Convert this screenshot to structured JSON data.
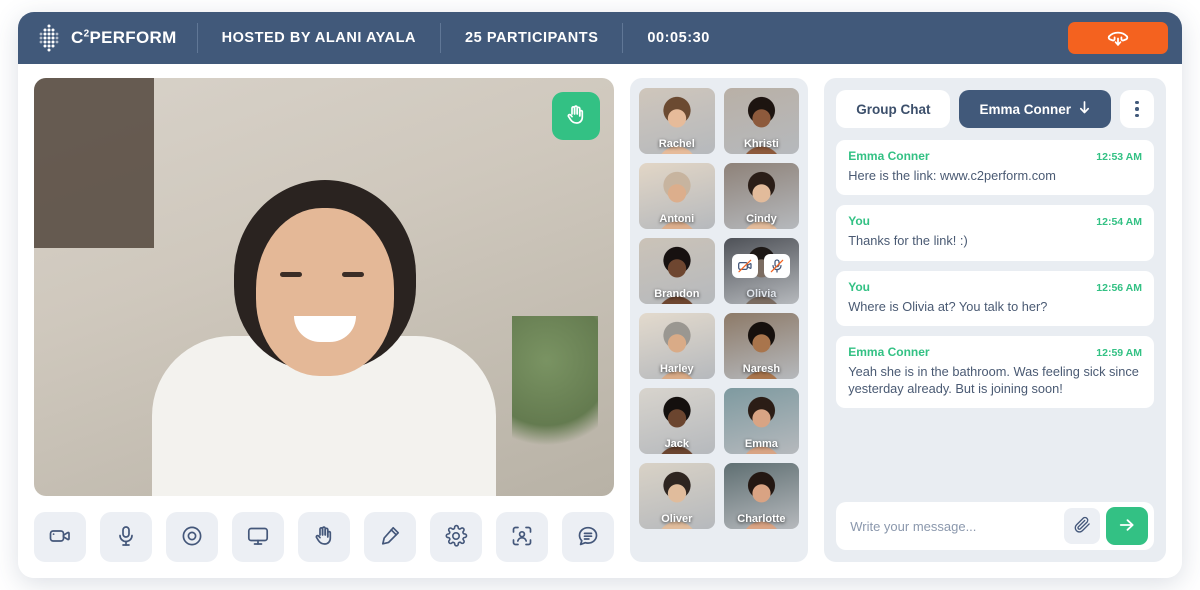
{
  "header": {
    "logo_icon": "c2perform-dot-matrix-logo",
    "logo_text": "C",
    "logo_sup": "2",
    "logo_text_rest": "PERFORM",
    "host": "HOSTED BY ALANI AYALA",
    "participants": "25 PARTICIPANTS",
    "timer": "00:05:30",
    "end_call_icon": "phone-hangup-icon"
  },
  "stage": {
    "raise_hand_icon": "raise-hand-icon",
    "controls": [
      {
        "name": "camera-toggle",
        "icon": "video-camera-icon"
      },
      {
        "name": "microphone-toggle",
        "icon": "microphone-icon"
      },
      {
        "name": "record-button",
        "icon": "record-circle-icon"
      },
      {
        "name": "share-screen-button",
        "icon": "monitor-icon"
      },
      {
        "name": "raise-hand-button",
        "icon": "raise-hand-icon"
      },
      {
        "name": "annotate-button",
        "icon": "pen-icon"
      },
      {
        "name": "settings-button",
        "icon": "gear-icon"
      },
      {
        "name": "participants-button",
        "icon": "person-frame-icon"
      },
      {
        "name": "chat-button",
        "icon": "chat-bubble-icon"
      }
    ]
  },
  "participants": [
    {
      "name": "Rachel",
      "muted": false,
      "skin": "#e6bb9a",
      "hair": "#6b4a31",
      "bg": "#cfc6bb"
    },
    {
      "name": "Khristi",
      "muted": false,
      "skin": "#8d5a3c",
      "hair": "#1d1410",
      "bg": "#b9b0a6"
    },
    {
      "name": "Antoni",
      "muted": false,
      "skin": "#dcae8c",
      "hair": "#c7b49f",
      "bg": "#e2d6c6"
    },
    {
      "name": "Cindy",
      "muted": false,
      "skin": "#e2bb9b",
      "hair": "#2a1d17",
      "bg": "#8e8279"
    },
    {
      "name": "Brandon",
      "muted": false,
      "skin": "#6e4630",
      "hair": "#171110",
      "bg": "#cbc3b8"
    },
    {
      "name": "Olivia",
      "muted": true,
      "skin": "#d7ab8b",
      "hair": "#33261f",
      "bg": "#7b8496"
    },
    {
      "name": "Harley",
      "muted": false,
      "skin": "#d9ab87",
      "hair": "#9a9791",
      "bg": "#e3dacd"
    },
    {
      "name": "Naresh",
      "muted": false,
      "skin": "#a9754c",
      "hair": "#16100d",
      "bg": "#8d7a68"
    },
    {
      "name": "Jack",
      "muted": false,
      "skin": "#6b452f",
      "hair": "#14100e",
      "bg": "#d8d4cd"
    },
    {
      "name": "Emma",
      "muted": false,
      "skin": "#d8a484",
      "hair": "#2b1d16",
      "bg": "#7e9aa0"
    },
    {
      "name": "Oliver",
      "muted": false,
      "skin": "#e0bc9c",
      "hair": "#2e2520",
      "bg": "#d9d2c6"
    },
    {
      "name": "Charlotte",
      "muted": false,
      "skin": "#d9a383",
      "hair": "#231712",
      "bg": "#5f6f72"
    }
  ],
  "muted_badges": {
    "camera_off_icon": "camera-off-icon",
    "mic_off_icon": "microphone-off-icon"
  },
  "chat": {
    "tab_group": "Group Chat",
    "tab_direct": "Emma Conner",
    "tab_direct_icon": "arrow-down-icon",
    "kebab_icon": "more-options-icon",
    "messages": [
      {
        "sender": "Emma Conner",
        "time": "12:53 AM",
        "text": "Here is the link: www.c2perform.com"
      },
      {
        "sender": "You",
        "time": "12:54 AM",
        "text": "Thanks for the link! :)"
      },
      {
        "sender": "You",
        "time": "12:56 AM",
        "text": "Where is Olivia at? You talk to her?"
      },
      {
        "sender": "Emma Conner",
        "time": "12:59 AM",
        "text": "Yeah she is in the bathroom. Was feeling sick since yesterday already. But is joining soon!"
      }
    ],
    "composer_value": "",
    "composer_placeholder": "Write your message...",
    "attach_icon": "paperclip-icon",
    "send_icon": "arrow-right-icon"
  },
  "colors": {
    "header": "#41597a",
    "accent_green": "#33c184",
    "accent_orange": "#f4621f",
    "panel": "#e9edf2",
    "text_dark": "#4a5a73"
  }
}
